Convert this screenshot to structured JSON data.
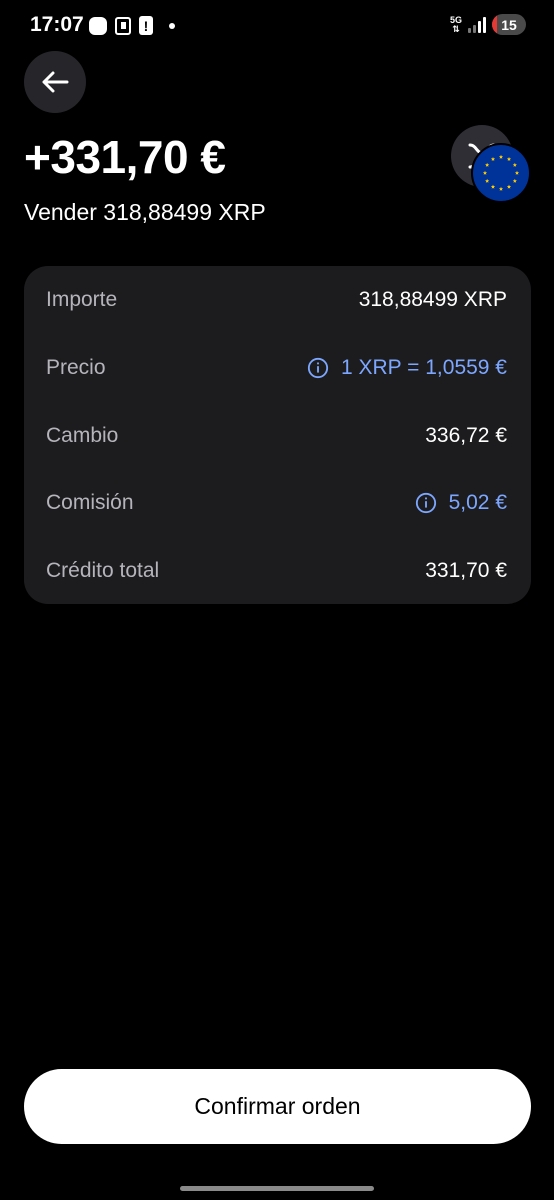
{
  "status_bar": {
    "time": "17:07",
    "network": "5G",
    "battery_level": "15",
    "battery_fraction": 0.15
  },
  "header": {
    "back_icon": "arrow-left-icon",
    "amount": "+331,70 €",
    "subtitle": "Vender 318,88499 XRP",
    "asset_icon": "xrp-icon",
    "currency_icon": "eu-flag-icon"
  },
  "details": {
    "rows": [
      {
        "label": "Importe",
        "value": "318,88499 XRP",
        "has_info": false
      },
      {
        "label": "Precio",
        "value": "1 XRP = 1,0559 €",
        "has_info": true
      },
      {
        "label": "Cambio",
        "value": "336,72 €",
        "has_info": false
      },
      {
        "label": "Comisión",
        "value": "5,02 €",
        "has_info": true
      },
      {
        "label": "Crédito total",
        "value": "331,70 €",
        "has_info": false
      }
    ]
  },
  "actions": {
    "confirm_label": "Confirmar orden"
  },
  "colors": {
    "background": "#000000",
    "card": "#1c1c1f",
    "label": "#b4b4ba",
    "link": "#7da7ff",
    "button": "#ffffff",
    "eu_blue": "#003399",
    "eu_star": "#ffcc00"
  }
}
